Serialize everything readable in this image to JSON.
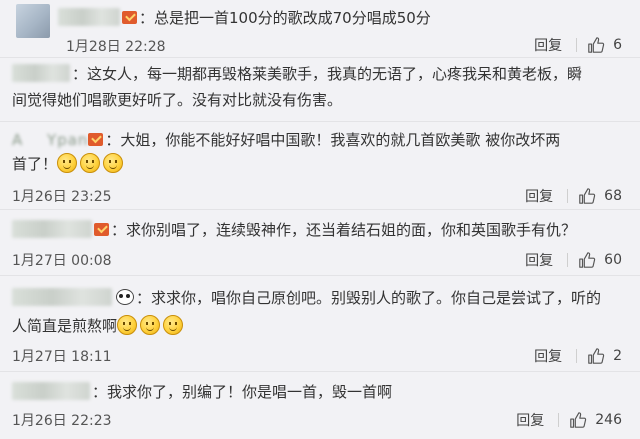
{
  "comments": [
    {
      "text": "：总是把一首100分的歌改成70分唱成50分",
      "date": "1月28日 22:28",
      "reply_label": "回复",
      "likes": "6"
    },
    {
      "text_line1": "：这女人，每一期都再毁格莱美歌手，我真的无语了，心疼我呆和黄老板，瞬",
      "text_line2": "间觉得她们唱歌更好听了。没有对比就没有伤害。"
    },
    {
      "username_partial": "A    Ypan",
      "text_line1": "：大姐，你能不能好好唱中国歌！我喜欢的就几首欧美歌 被你改坏两",
      "text_line2": "首了！",
      "date": "1月26日 23:25",
      "reply_label": "回复",
      "likes": "68"
    },
    {
      "text": "：求你别唱了，连续毁神作，还当着结石姐的面，你和英国歌手有仇？",
      "date": "1月27日 00:08",
      "reply_label": "回复",
      "likes": "60"
    },
    {
      "text_line1": "：求求你，唱你自己原创吧。别毁别人的歌了。你自己是尝试了，听的",
      "text_line2": "人简直是煎熬啊",
      "date": "1月27日 18:11",
      "reply_label": "回复",
      "likes": "2"
    },
    {
      "text": "：我求你了，别编了！你是唱一首，毁一首啊",
      "date": "1月26日 22:23",
      "reply_label": "回复",
      "likes": "246"
    }
  ]
}
